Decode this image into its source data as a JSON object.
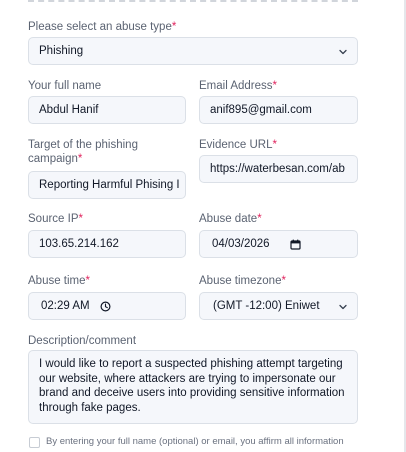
{
  "form": {
    "abuse_type": {
      "label": "Please select an abuse type",
      "required": "*",
      "value": "Phishing"
    },
    "full_name": {
      "label": "Your full name",
      "value": "Abdul Hanif"
    },
    "email": {
      "label": "Email Address",
      "required": "*",
      "value": "anif895@gmail.com"
    },
    "target": {
      "label_line1": "Target of the phishing",
      "label_line2": "campaign",
      "required": "*",
      "value": "Reporting Harmful Phising I"
    },
    "evidence_url": {
      "label": "Evidence URL",
      "required": "*",
      "value": "https://waterbesan.com/ab"
    },
    "source_ip": {
      "label": "Source IP",
      "required": "*",
      "value": "103.65.214.162"
    },
    "abuse_date": {
      "label": "Abuse date",
      "required": "*",
      "value": "04/03/2026"
    },
    "abuse_time": {
      "label": "Abuse time",
      "required": "*",
      "value": "02:29 AM"
    },
    "abuse_timezone": {
      "label": "Abuse timezone",
      "required": "*",
      "value": "(GMT -12:00) Eniwet"
    },
    "description": {
      "label": "Description/comment",
      "value": "I would like to report a suspected phishing attempt targeting our website, where attackers are trying to impersonate our brand and deceive users into providing sensitive information through fake pages."
    },
    "consent_text": "By entering your full name (optional) or email, you affirm all information"
  },
  "icons": {
    "chevron": "chevron-down-icon",
    "calendar": "calendar-icon",
    "clock": "clock-icon"
  }
}
